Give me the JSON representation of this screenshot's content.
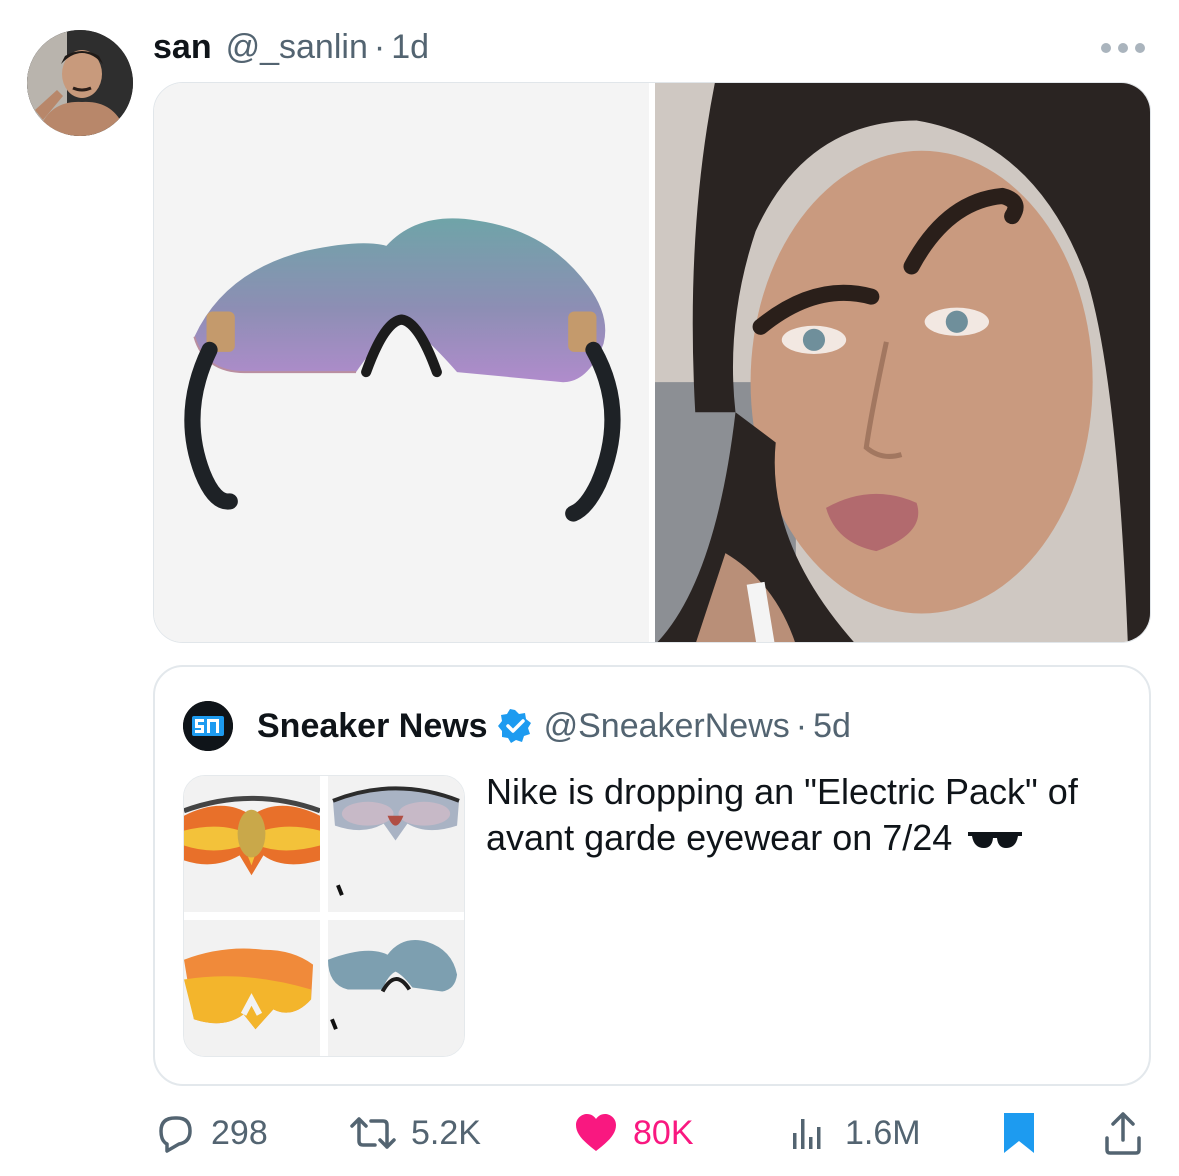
{
  "post": {
    "author_name": "san",
    "author_handle": "@_sanlin",
    "separator": "·",
    "time": "1d",
    "more_icon": "more-horizontal-icon"
  },
  "media": [
    {
      "kind": "photo",
      "subject": "sunglasses-product"
    },
    {
      "kind": "photo",
      "subject": "selfie"
    }
  ],
  "quoted_post": {
    "author_name": "Sneaker News",
    "verified": true,
    "author_handle": "@SneakerNews",
    "separator": "·",
    "time": "5d",
    "text": "Nike is dropping an \"Electric Pack\" of avant garde eyewear on 7/24",
    "text_emoji": "sunglasses-emoji",
    "media_count": 4
  },
  "actions": {
    "replies": "298",
    "retweets": "5.2K",
    "likes": "80K",
    "views": "1.6M"
  },
  "colors": {
    "text_primary": "#0f1419",
    "text_secondary": "#536471",
    "like_active": "#f91880",
    "bookmark_active": "#1d9bf0",
    "verified": "#1d9bf0",
    "border": "#e1e6ea"
  }
}
